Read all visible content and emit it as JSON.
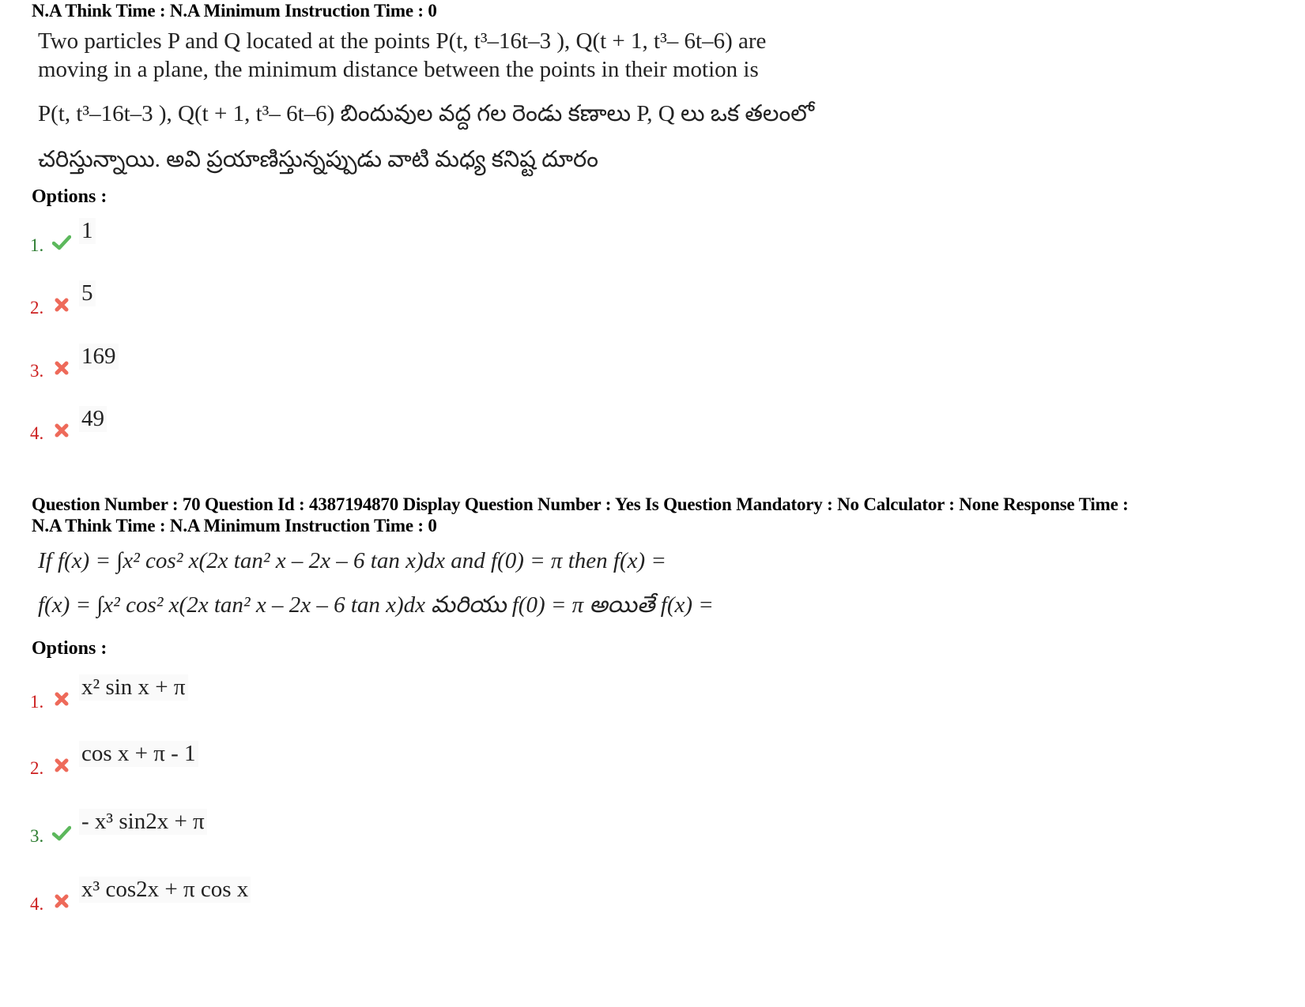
{
  "q69": {
    "meta_line2": "N.A Think Time : N.A Minimum Instruction Time : 0",
    "text_en_1": "Two particles P and Q located at the points P(t, t³–16t–3 ), Q(t + 1, t³– 6t–6) are",
    "text_en_2": "moving in a plane, the minimum distance between the points in their motion is",
    "text_te_1": "P(t, t³–16t–3 ), Q(t + 1, t³– 6t–6) బిందువుల వద్ద గల రెండు కణాలు P, Q లు ఒక తలంలో",
    "text_te_2": "చరిస్తున్నాయి. అవి ప్రయాణిస్తున్నప్పుడు వాటి మధ్య కనిష్ట దూరం",
    "options_label": "Options :",
    "options": [
      {
        "num": "1.",
        "value": "1",
        "status": "correct"
      },
      {
        "num": "2.",
        "value": "5",
        "status": "wrong"
      },
      {
        "num": "3.",
        "value": "169",
        "status": "wrong"
      },
      {
        "num": "4.",
        "value": "49",
        "status": "wrong"
      }
    ]
  },
  "q70": {
    "meta_line1": "Question Number : 70 Question Id : 4387194870 Display Question Number : Yes Is Question Mandatory : No Calculator : None Response Time :",
    "meta_line2": "N.A Think Time : N.A Minimum Instruction Time : 0",
    "text_en": "If f(x) = ∫x² cos² x(2x tan² x – 2x – 6 tan x)dx  and f(0) = π then  f(x) =",
    "text_te": "f(x) = ∫x² cos² x(2x tan² x – 2x – 6 tan x)dx  మరియు f(0) = π అయితే  f(x) =",
    "options_label": "Options :",
    "options": [
      {
        "num": "1.",
        "value": "x² sin x + π",
        "status": "wrong"
      },
      {
        "num": "2.",
        "value": "cos x + π - 1",
        "status": "wrong"
      },
      {
        "num": "3.",
        "value": "- x³ sin2x + π",
        "status": "correct"
      },
      {
        "num": "4.",
        "value": "x³ cos2x + π cos x",
        "status": "wrong"
      }
    ]
  },
  "colors": {
    "correct": "#2e7d32",
    "wrong": "#cc1f1f",
    "check_icon": "#5cb85c",
    "cross_icon": "#ee6a5a"
  }
}
